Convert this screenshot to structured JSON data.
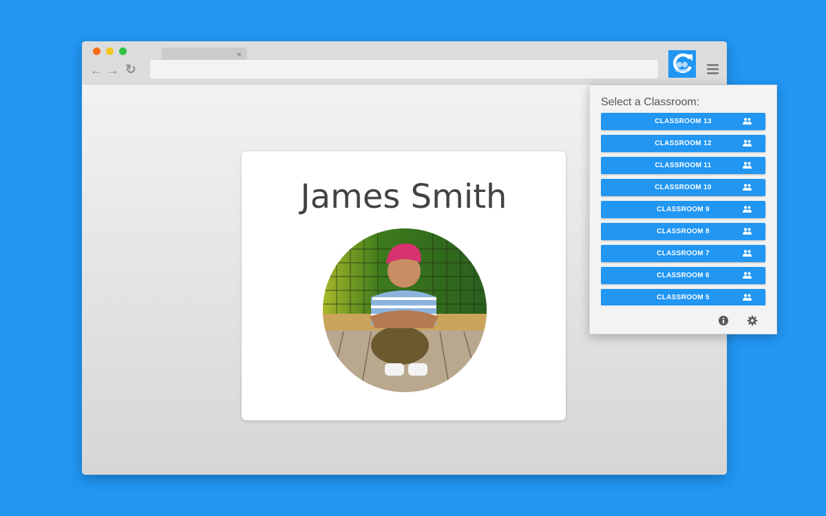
{
  "browser": {
    "tab": {
      "title": "",
      "close_glyph": "×"
    },
    "nav": {
      "back_glyph": "←",
      "forward_glyph": "→",
      "reload_glyph": "↻"
    },
    "address_bar": {
      "value": ""
    },
    "extension_icon": "classroom-refresh-icon",
    "menu_icon": "hamburger-menu-icon"
  },
  "card": {
    "student_name": "James Smith",
    "photo": "student-photo"
  },
  "popup": {
    "title": "Select a Classroom:",
    "classrooms": [
      {
        "label": "CLASSROOM 13",
        "icon": "group-icon"
      },
      {
        "label": "CLASSROOM 12",
        "icon": "group-icon"
      },
      {
        "label": "CLASSROOM 11",
        "icon": "group-icon"
      },
      {
        "label": "CLASSROOM 10",
        "icon": "group-icon"
      },
      {
        "label": "CLASSROOM 9",
        "icon": "group-icon"
      },
      {
        "label": "CLASSROOM 8",
        "icon": "group-icon"
      },
      {
        "label": "CLASSROOM 7",
        "icon": "group-icon"
      },
      {
        "label": "CLASSROOM 6",
        "icon": "group-icon"
      },
      {
        "label": "CLASSROOM 5",
        "icon": "group-icon"
      }
    ],
    "footer": {
      "info_icon": "info-icon",
      "settings_icon": "gear-icon"
    }
  },
  "colors": {
    "brand": "#2196f3",
    "text_dark": "#424242",
    "popup_bg": "#f3f3f3"
  }
}
